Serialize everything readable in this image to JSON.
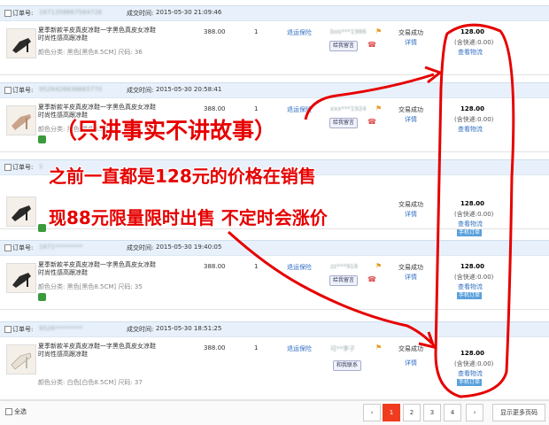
{
  "labels": {
    "order_no": "订单号:",
    "deal_time": "成交时间:",
    "after_sale": "退运保险",
    "status": "交易成功",
    "detail": "详情",
    "shipping": "(含快递:0.00)",
    "logistics": "查看物流",
    "chat": "给我留言",
    "chat_alt": "和我联系",
    "memo": "手机订单"
  },
  "orders": [
    {
      "order_no": "1671358867564726",
      "time": "2015-05-30 21:09:46",
      "name": "夏季新款羊皮真皮凉鞋一字黑色真皮女凉鞋时尚性感高跟凉鞋",
      "spec": "颜色分类: 黑色[黑色8.5CM] 尺码: 36",
      "price": "388.00",
      "qty": "1",
      "buyer": "bos***1986",
      "amount": "128.00"
    },
    {
      "order_no": "9526426836665770",
      "time": "2015-05-30 20:58:41",
      "name": "夏季新款羊皮真皮凉鞋一字黑色真皮女凉鞋时尚性感高跟凉鞋",
      "spec": "颜色分类: 黑色[黑色8.5CM]",
      "price": "388.00",
      "qty": "1",
      "buyer": "xxx***1924",
      "amount": "128.00"
    },
    {
      "order_no": "1",
      "time": "",
      "name": "",
      "spec": "",
      "price": "",
      "qty": "",
      "buyer": "",
      "amount": "128.00"
    },
    {
      "order_no": "1671*********",
      "time": "2015-05-30 19:40:05",
      "name": "夏季新款羊皮真皮凉鞋一字黑色真皮女凉鞋时尚性感高跟凉鞋",
      "spec": "颜色分类: 黑色[黑色8.5CM] 尺码: 35",
      "price": "388.00",
      "qty": "1",
      "buyer": "zz***918",
      "amount": "128.00"
    },
    {
      "order_no": "9526*********",
      "time": "2015-05-30 18:51:25",
      "name": "夏季新款羊皮真皮凉鞋一字黑色真皮女凉鞋时尚性感高跟凉鞋",
      "spec": "颜色分类: 白色[白色8.5CM] 尺码: 37",
      "price": "388.00",
      "qty": "1",
      "buyer": "可**李子",
      "amount": "128.00"
    }
  ],
  "overlay": {
    "line1": "（只讲事实不讲故事）",
    "line2": "之前一直都是128元的价格在销售",
    "line3": "现88元限量限时出售    不定时会涨价"
  },
  "footer": {
    "select_all": "全选",
    "pages": [
      "1",
      "2",
      "3",
      "4"
    ],
    "prev": "‹",
    "next": "›",
    "more": "显示更多页码"
  },
  "colors": {
    "accent": "#f03c1e",
    "link": "#2f6ec2",
    "annotation": "#e60000"
  }
}
